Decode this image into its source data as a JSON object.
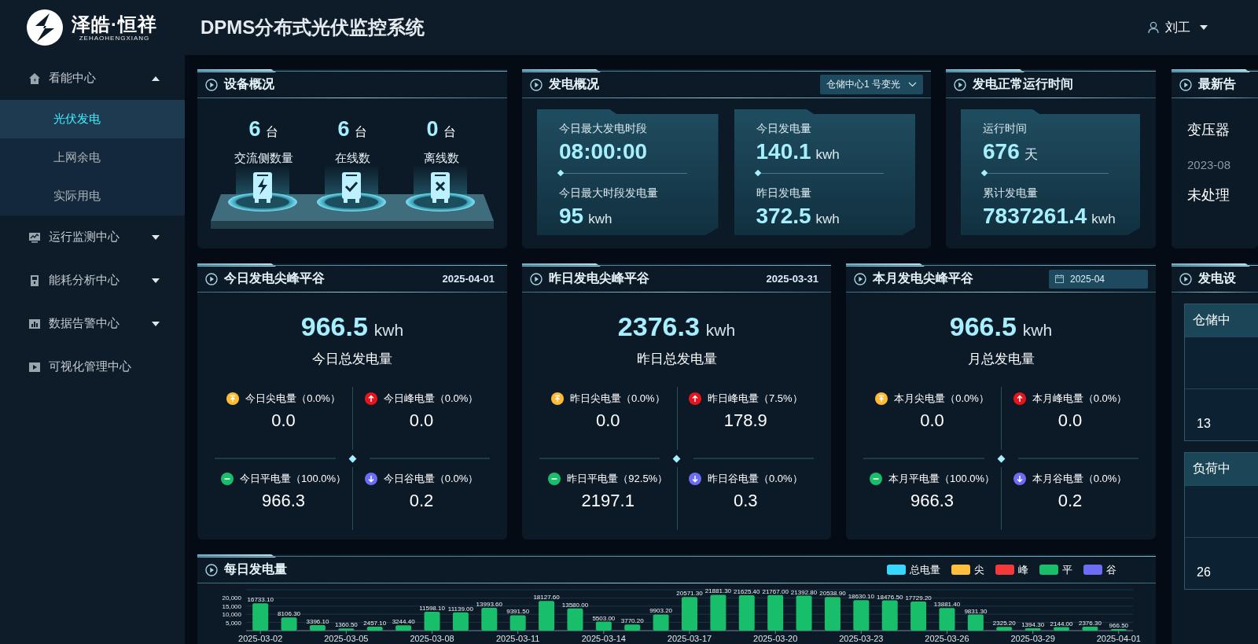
{
  "header": {
    "logo_text": "泽皓·恒祥",
    "logo_subtitle": "ZEHAOHENGXIANG",
    "title": "DPMS分布式光伏监控系统",
    "user": "刘工"
  },
  "sidebar": {
    "items": [
      {
        "label": "看能中心",
        "kind": "home",
        "expanded": true,
        "children": [
          {
            "label": "光伏发电",
            "selected": true
          },
          {
            "label": "上网余电",
            "selected": false
          },
          {
            "label": "实际用电",
            "selected": false
          }
        ]
      },
      {
        "label": "运行监测中心",
        "kind": "monitor",
        "expanded": false
      },
      {
        "label": "能耗分析中心",
        "kind": "meter",
        "expanded": false
      },
      {
        "label": "数据告警中心",
        "kind": "chart",
        "expanded": false
      },
      {
        "label": "可视化管理中心",
        "kind": "video"
      }
    ]
  },
  "device_overview": {
    "title": "设备概况",
    "stats": [
      {
        "value": "6",
        "unit": "台",
        "label": "交流侧数量",
        "kind": "power"
      },
      {
        "value": "6",
        "unit": "台",
        "label": "在线数",
        "kind": "online"
      },
      {
        "value": "0",
        "unit": "台",
        "label": "离线数",
        "kind": "offline"
      }
    ]
  },
  "generation_overview": {
    "title": "发电概况",
    "station_select": "仓储中心1 号变光",
    "panels": [
      {
        "metrics": [
          {
            "label": "今日最大发电时段",
            "value": "08:00:00"
          },
          {
            "label": "今日最大时段发电量",
            "value": "95",
            "unit": "kwh"
          }
        ]
      },
      {
        "metrics": [
          {
            "label": "今日发电量",
            "value": "140.1",
            "unit": "kwh"
          },
          {
            "label": "昨日发电量",
            "value": "372.5",
            "unit": "kwh"
          }
        ]
      }
    ]
  },
  "runtime": {
    "title": "发电正常运行时间",
    "panels": [
      {
        "metrics": [
          {
            "label": "运行时间",
            "value": "676",
            "unit": "天"
          },
          {
            "label": "累计发电量",
            "value": "7837261.4",
            "unit": "kwh"
          }
        ]
      }
    ]
  },
  "alerts": {
    "title": "最新告",
    "lines": [
      {
        "kind": "name",
        "text": "变压器"
      },
      {
        "kind": "date",
        "text": "2023-08"
      },
      {
        "kind": "status",
        "text": "未处理"
      }
    ]
  },
  "peak_cards": [
    {
      "title": "今日发电尖峰平谷",
      "date": {
        "kind": "text",
        "text": "2025-04-01"
      },
      "total": "966.5",
      "unit": "kwh",
      "total_label": "今日总发电量",
      "items": [
        {
          "kind": "sharp",
          "label": "今日尖电量（0.0%）",
          "value": "0.0"
        },
        {
          "kind": "peak",
          "label": "今日峰电量（0.0%）",
          "value": "0.0"
        },
        {
          "kind": "flat",
          "label": "今日平电量（100.0%）",
          "value": "966.3"
        },
        {
          "kind": "valley",
          "label": "今日谷电量（0.0%）",
          "value": "0.2"
        }
      ]
    },
    {
      "title": "昨日发电尖峰平谷",
      "date": {
        "kind": "text",
        "text": "2025-03-31"
      },
      "total": "2376.3",
      "unit": "kwh",
      "total_label": "昨日总发电量",
      "items": [
        {
          "kind": "sharp",
          "label": "昨日尖电量（0.0%）",
          "value": "0.0"
        },
        {
          "kind": "peak",
          "label": "昨日峰电量（7.5%）",
          "value": "178.9"
        },
        {
          "kind": "flat",
          "label": "昨日平电量（92.5%）",
          "value": "2197.1"
        },
        {
          "kind": "valley",
          "label": "昨日谷电量（0.0%）",
          "value": "0.3"
        }
      ]
    },
    {
      "title": "本月发电尖峰平谷",
      "date": {
        "kind": "picker",
        "text": "2025-04"
      },
      "total": "966.5",
      "unit": "kwh",
      "total_label": "月总发电量",
      "items": [
        {
          "kind": "sharp",
          "label": "本月尖电量（0.0%）",
          "value": "0.0"
        },
        {
          "kind": "peak",
          "label": "本月峰电量（0.0%）",
          "value": "0.0"
        },
        {
          "kind": "flat",
          "label": "本月平电量（100.0%）",
          "value": "966.3"
        },
        {
          "kind": "valley",
          "label": "本月谷电量（0.0%）",
          "value": "0.2"
        }
      ]
    }
  ],
  "stations": {
    "title": "发电设",
    "boxes": [
      {
        "name": "仓储中",
        "value": "13"
      },
      {
        "name": "负荷中",
        "value": "26"
      }
    ]
  },
  "daily_chart": {
    "title": "每日发电量",
    "legend": [
      {
        "label": "总电量",
        "color": "#36d6ff"
      },
      {
        "label": "尖",
        "color": "#ffbf3c"
      },
      {
        "label": "峰",
        "color": "#f23a3a"
      },
      {
        "label": "平",
        "color": "#19be6b"
      },
      {
        "label": "谷",
        "color": "#6c6cf5"
      }
    ],
    "chart_data": {
      "type": "bar",
      "categories": [
        "2025-03-02",
        null,
        null,
        "2025-03-05",
        null,
        null,
        "2025-03-08",
        null,
        null,
        "2025-03-11",
        null,
        null,
        "2025-03-14",
        null,
        null,
        "2025-03-17",
        null,
        null,
        "2025-03-20",
        null,
        null,
        "2025-03-23",
        null,
        null,
        "2025-03-26",
        null,
        null,
        "2025-03-29",
        null,
        null,
        "2025-04-01"
      ],
      "series": [
        {
          "color": "#19be6b",
          "values": [
            16733.1,
            8106.3,
            3396.1,
            1360.5,
            2457.1,
            3244.4,
            11598.1,
            11139.0,
            13993.6,
            9391.5,
            18127.6,
            13580.0,
            5503.0,
            3770.2,
            9903.2,
            20571.3,
            21881.3,
            21625.4,
            21767.0,
            21392.8,
            20538.9,
            18630.1,
            18476.5,
            17729.2,
            13881.4,
            9831.3,
            2325.2,
            1394.3,
            2144.0,
            2376.3,
            966.5
          ]
        }
      ],
      "value_labels": [
        "16733.10",
        "8106.30",
        "3396.10",
        "1360.50",
        "2457.10",
        "3244.40",
        "11598.10",
        "11139.00",
        "13993.60",
        "9391.50",
        "18127.60",
        "13580.00",
        "5503.00",
        "3770.20",
        "9903.20",
        "20571.30",
        "21881.30",
        "21625.40",
        "21767.00",
        "21392.80",
        "20538.90",
        "18630.10",
        "18476.50",
        "17729.20",
        "13881.40",
        "9831.30",
        "2325.20",
        "1394.30",
        "2144.00",
        "2376.30",
        "966.50"
      ],
      "grid": true,
      "ylim": [
        0,
        25000
      ],
      "yticks": [
        {
          "value": 5000,
          "label": "5,000"
        },
        {
          "value": 10000,
          "label": "10,000"
        },
        {
          "value": 15000,
          "label": "15,000"
        },
        {
          "value": 20000,
          "label": "20,000"
        }
      ],
      "orientation": "vertical"
    }
  }
}
